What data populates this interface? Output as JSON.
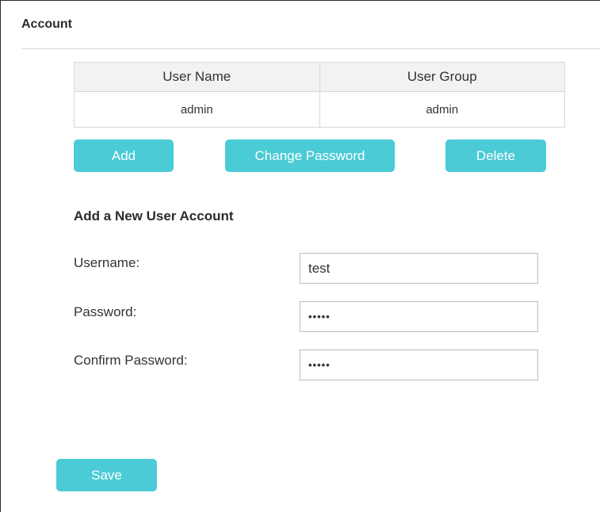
{
  "header": {
    "title": "Account"
  },
  "table": {
    "columns": [
      "User Name",
      "User Group"
    ],
    "rows": [
      {
        "user_name": "admin",
        "user_group": "admin"
      }
    ]
  },
  "actions": {
    "add_label": "Add",
    "change_password_label": "Change Password",
    "delete_label": "Delete"
  },
  "new_user": {
    "heading": "Add a New User Account",
    "username_label": "Username:",
    "username_value": "test",
    "password_label": "Password:",
    "password_value": "•••••",
    "confirm_label": "Confirm Password:",
    "confirm_value": "•••••"
  },
  "footer": {
    "save_label": "Save"
  },
  "colors": {
    "button": "#4acbd6",
    "table_header_bg": "#f2f2f2",
    "border": "#d7d7d7"
  }
}
